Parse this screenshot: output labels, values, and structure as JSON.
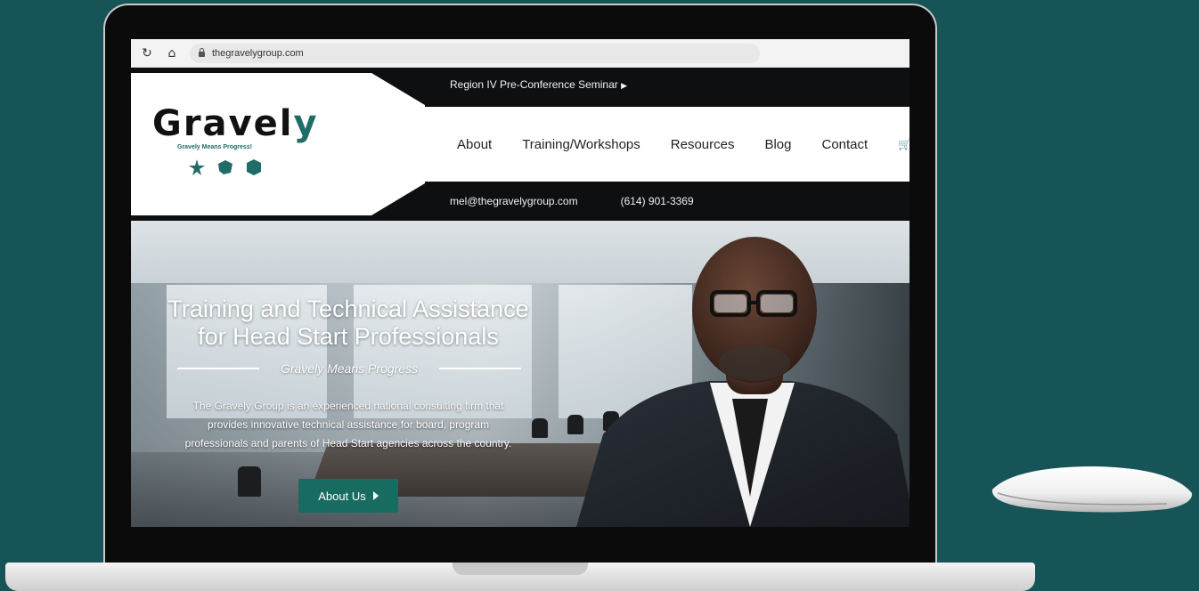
{
  "browser": {
    "url": "thegravelygroup.com"
  },
  "header": {
    "logo_text": "Gravel",
    "logo_text_accent": "y",
    "logo_tagline": "Gravely Means Progress!",
    "announcement": "Region IV Pre-Conference Seminar",
    "email": "mel@thegravelygroup.com",
    "phone": "(614) 901-3369"
  },
  "nav": {
    "items": [
      {
        "label": "About"
      },
      {
        "label": "Training/Workshops"
      },
      {
        "label": "Resources"
      },
      {
        "label": "Blog"
      },
      {
        "label": "Contact"
      }
    ]
  },
  "hero": {
    "title_line1": "Training and Technical Assistance",
    "title_line2": "for Head Start Professionals",
    "subtitle": "Gravely Means Progress",
    "body_line1": "The Gravely Group is an experienced national consulting firm that",
    "body_line2": "provides innovative technical assistance for board, program",
    "body_line3": "professionals and parents of Head Start agencies across the country.",
    "cta_label": "About Us"
  },
  "colors": {
    "background": "#175458",
    "brand_green": "#186b60",
    "header_dark": "#0e0f10"
  },
  "icons": [
    "reload-icon",
    "home-icon",
    "lock-icon",
    "cart-icon",
    "play-triangle-icon"
  ]
}
